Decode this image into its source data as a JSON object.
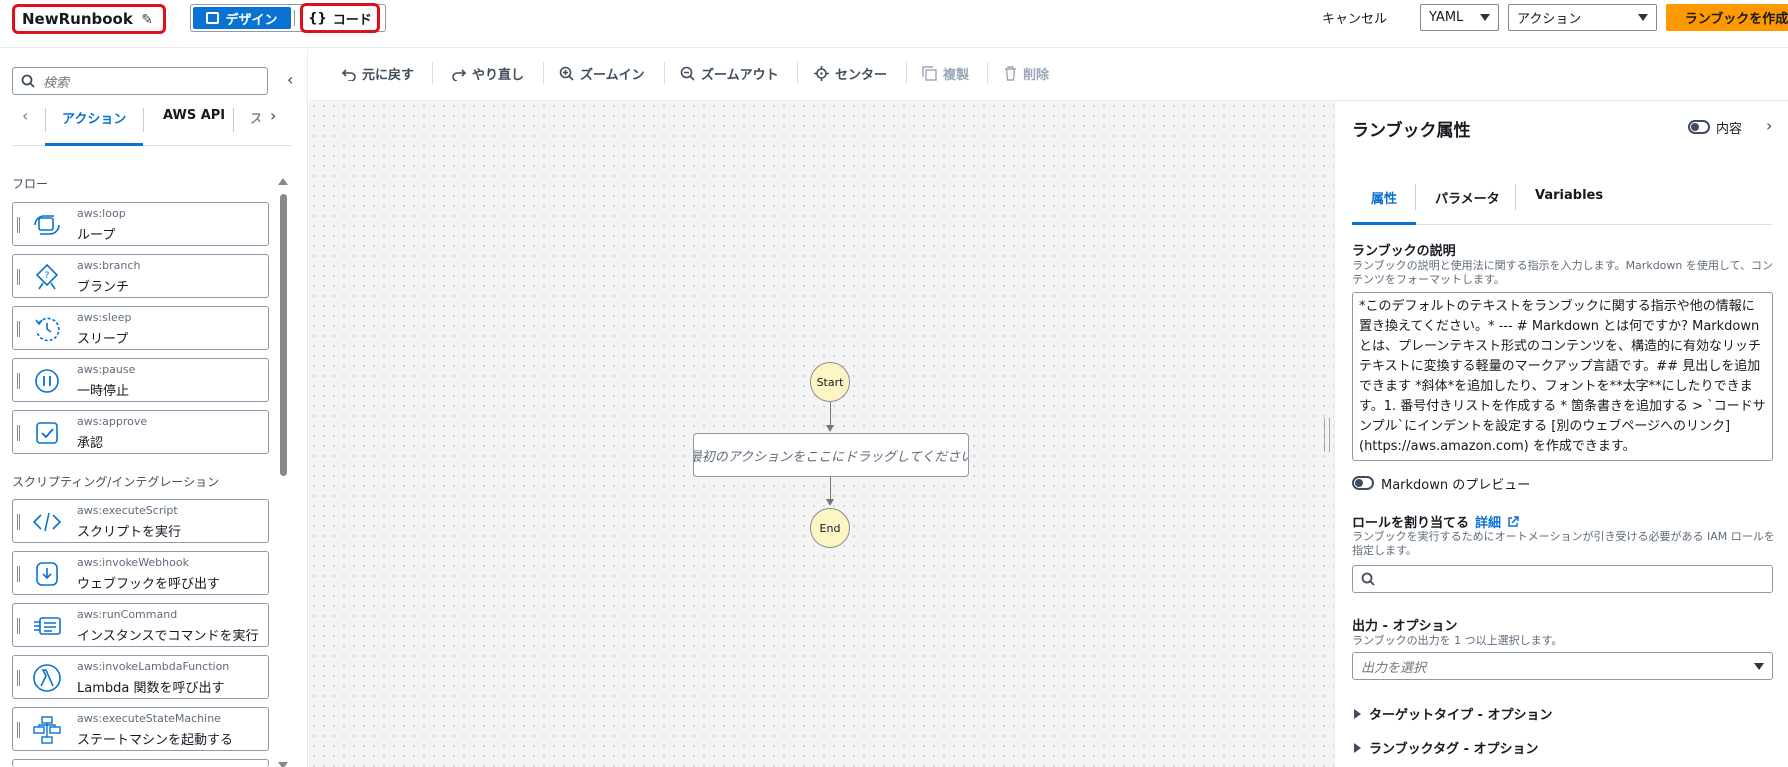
{
  "header": {
    "title": "NewRunbook",
    "design_label": "デザイン",
    "code_label": "コード",
    "code_icon": "{}",
    "cancel_label": "キャンセル",
    "format_value": "YAML",
    "action_label": "アクション",
    "create_label": "ランブックを作成"
  },
  "left": {
    "search_placeholder": "検索",
    "tabs": [
      "アクション",
      "AWS API",
      "ス"
    ],
    "sections": [
      {
        "label": "フロー",
        "items": [
          {
            "code": "aws:loop",
            "label": "ループ",
            "icon": "loop-icon"
          },
          {
            "code": "aws:branch",
            "label": "ブランチ",
            "icon": "branch-icon"
          },
          {
            "code": "aws:sleep",
            "label": "スリープ",
            "icon": "sleep-icon"
          },
          {
            "code": "aws:pause",
            "label": "一時停止",
            "icon": "pause-icon"
          },
          {
            "code": "aws:approve",
            "label": "承認",
            "icon": "approve-icon"
          }
        ]
      },
      {
        "label": "スクリプティング/インテグレーション",
        "items": [
          {
            "code": "aws:executeScript",
            "label": "スクリプトを実行",
            "icon": "code-icon"
          },
          {
            "code": "aws:invokeWebhook",
            "label": "ウェブフックを呼び出す",
            "icon": "webhook-icon"
          },
          {
            "code": "aws:runCommand",
            "label": "インスタンスでコマンドを実行",
            "icon": "run-command-icon"
          },
          {
            "code": "aws:invokeLambdaFunction",
            "label": "Lambda 関数を呼び出す",
            "icon": "lambda-icon"
          },
          {
            "code": "aws:executeStateMachine",
            "label": "ステートマシンを起動する",
            "icon": "state-machine-icon"
          }
        ]
      }
    ]
  },
  "toolbar": {
    "undo": "元に戻す",
    "redo": "やり直し",
    "zoom_in": "ズームイン",
    "zoom_out": "ズームアウト",
    "center": "センター",
    "duplicate": "複製",
    "delete": "削除"
  },
  "canvas": {
    "start": "Start",
    "end": "End",
    "drop_text": "最初のアクションをここにドラッグしてください"
  },
  "right": {
    "title": "ランブック属性",
    "content_toggle": "内容",
    "tabs": [
      "属性",
      "パラメータ",
      "Variables"
    ],
    "description_label": "ランブックの説明",
    "description_hint": "ランブックの説明と使用法に関する指示を入力します。Markdown を使用して、コンテンツをフォーマットします。",
    "description_value": "*このデフォルトのテキストをランブックに関する指示や他の情報に置き換えてください。* --- # Markdown とは何ですか? Markdown とは、プレーンテキスト形式のコンテンツを、構造的に有効なリッチテキストに変換する軽量のマークアップ言語です。## 見出しを追加できます *斜体*を追加したり、フォントを**太字**にしたりできます。1. 番号付きリストを作成する * 箇条書きを追加する > `コードサンプル`にインデントを設定する [別のウェブページへのリンク](https://aws.amazon.com) を作成できます。",
    "markdown_preview": "Markdown のプレビュー",
    "role_label": "ロールを割り当てる",
    "role_link": "詳細",
    "role_hint": "ランブックを実行するためにオートメーションが引き受ける必要がある IAM ロールを指定します。",
    "output_label": "出力 - オプション",
    "output_hint": "ランブックの出力を 1 つ以上選択します。",
    "output_placeholder": "出力を選択",
    "target_type": "ターゲットタイプ - オプション",
    "runbook_tags": "ランブックタグ - オプション"
  }
}
